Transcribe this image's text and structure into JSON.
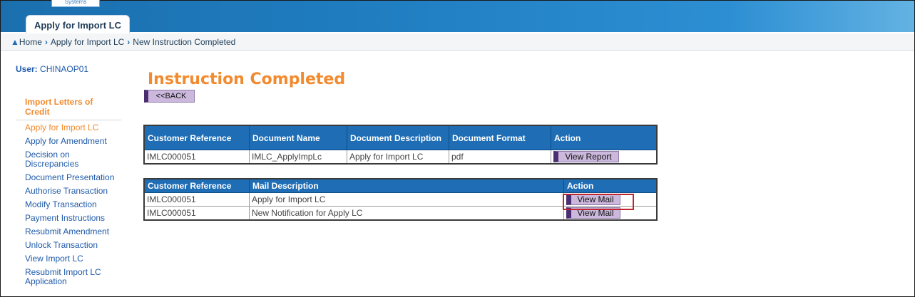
{
  "header": {
    "logo_text": "Systems",
    "tab_label": "Apply for Import LC"
  },
  "breadcrumb": {
    "items": [
      "Home",
      "Apply for Import LC",
      "New Instruction Completed"
    ]
  },
  "user": {
    "label": "User:",
    "name": "CHINAOP01"
  },
  "sidebar": {
    "section_title": "Import Letters of Credit",
    "items": [
      {
        "label": "Apply for Import LC",
        "active": true
      },
      {
        "label": "Apply for Amendment"
      },
      {
        "label": "Decision on Discrepancies"
      },
      {
        "label": "Document Presentation"
      },
      {
        "label": "Authorise Transaction"
      },
      {
        "label": "Modify Transaction"
      },
      {
        "label": "Payment Instructions"
      },
      {
        "label": "Resubmit Amendment"
      },
      {
        "label": "Unlock Transaction"
      },
      {
        "label": "View Import LC"
      },
      {
        "label": "Resubmit Import LC Application"
      }
    ]
  },
  "main": {
    "title": "Instruction Completed",
    "back_label": "<<BACK",
    "report_table": {
      "headers": [
        "Customer Reference",
        "Document Name",
        "Document Description",
        "Document Format",
        "Action"
      ],
      "rows": [
        {
          "customer_reference": "IMLC000051",
          "document_name": "IMLC_ApplyImpLc",
          "document_description": "Apply for Import LC",
          "document_format": "pdf",
          "action": "View Report"
        }
      ]
    },
    "mail_table": {
      "headers": [
        "Customer Reference",
        "Mail Description",
        "Action"
      ],
      "rows": [
        {
          "customer_reference": "IMLC000051",
          "mail_description": "Apply for Import LC",
          "action": "View Mail"
        },
        {
          "customer_reference": "IMLC000051",
          "mail_description": "New Notification for Apply LC",
          "action": "View Mail"
        }
      ]
    }
  },
  "colors": {
    "header_blue": "#1f6db5",
    "accent_orange": "#f28a2e",
    "button_purple": "#cbb8dc",
    "highlight_red": "#c0262d"
  }
}
